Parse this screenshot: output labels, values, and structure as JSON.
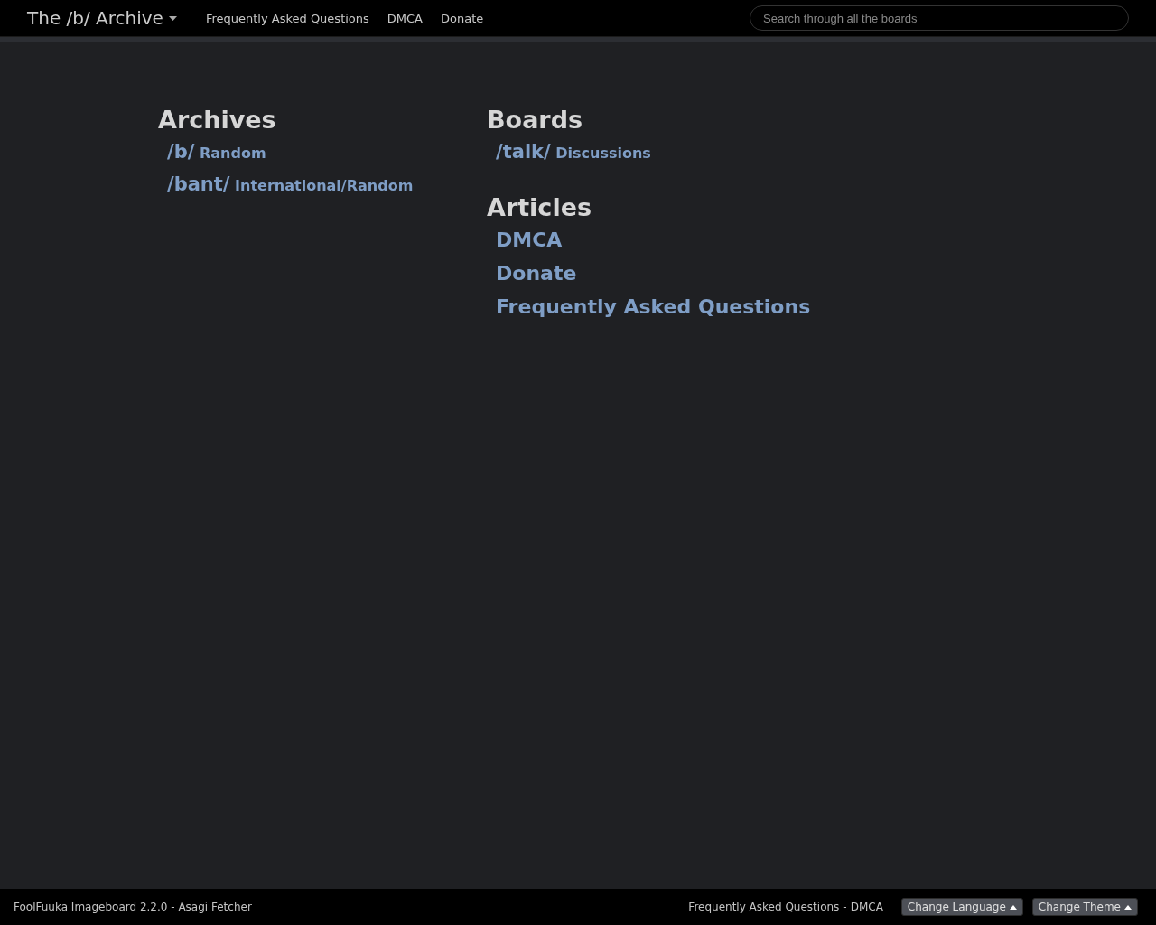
{
  "navbar": {
    "brand": "The /b/ Archive",
    "links": [
      "Frequently Asked Questions",
      "DMCA",
      "Donate"
    ],
    "search": {
      "placeholder": "Search through all the boards"
    }
  },
  "sections": [
    {
      "title": "Archives",
      "kind": "boards",
      "items": [
        {
          "code": "/b/",
          "name": "Random"
        },
        {
          "code": "/bant/",
          "name": "International/Random"
        }
      ]
    },
    {
      "title": "Boards",
      "kind": "boards",
      "items": [
        {
          "code": "/talk/",
          "name": "Discussions"
        }
      ]
    },
    {
      "title": "Articles",
      "kind": "articles",
      "items": [
        {
          "name": "DMCA"
        },
        {
          "name": "Donate"
        },
        {
          "name": "Frequently Asked Questions"
        }
      ]
    }
  ],
  "footer": {
    "credit": "FoolFuuka Imageboard 2.2.0 - Asagi Fetcher",
    "links": [
      "Frequently Asked Questions",
      "DMCA"
    ],
    "separator": "-",
    "buttons": [
      "Change Language",
      "Change Theme"
    ]
  }
}
